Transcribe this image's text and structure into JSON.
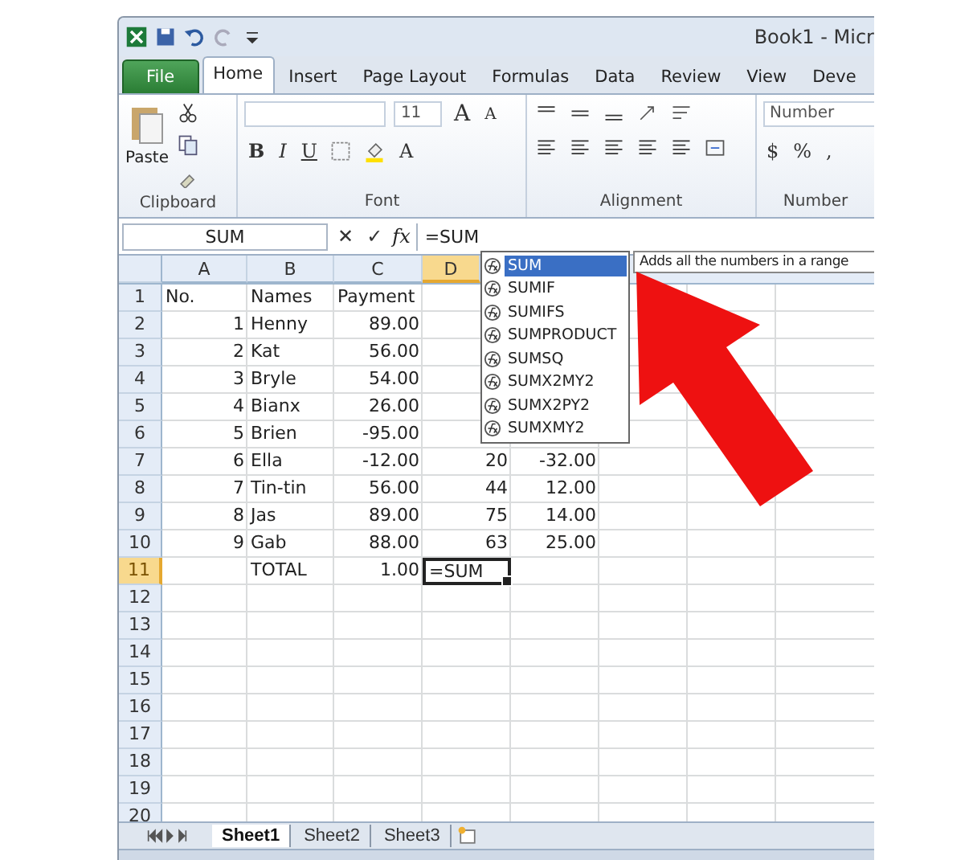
{
  "window": {
    "title": "Book1 - Micr"
  },
  "tabs": [
    {
      "label": "File",
      "kind": "file",
      "selected": false
    },
    {
      "label": "Home",
      "kind": "tab",
      "selected": true
    },
    {
      "label": "Insert",
      "kind": "tab",
      "selected": false
    },
    {
      "label": "Page Layout",
      "kind": "tab",
      "selected": false
    },
    {
      "label": "Formulas",
      "kind": "tab",
      "selected": false
    },
    {
      "label": "Data",
      "kind": "tab",
      "selected": false
    },
    {
      "label": "Review",
      "kind": "tab",
      "selected": false
    },
    {
      "label": "View",
      "kind": "tab",
      "selected": false
    },
    {
      "label": "Deve",
      "kind": "tab",
      "selected": false
    }
  ],
  "ribbon": {
    "clipboard": {
      "paste_label": "Paste",
      "group_label": "Clipboard"
    },
    "font": {
      "size": "11",
      "grow": "A",
      "shrink": "A",
      "styles": [
        "B",
        "I",
        "U"
      ],
      "color_letter": "A",
      "group_label": "Font"
    },
    "alignment": {
      "group_label": "Alignment"
    },
    "number": {
      "format": "Number",
      "buttons": [
        "$",
        "%",
        ","
      ],
      "group_label": "Number"
    }
  },
  "formula_bar": {
    "name_box": "SUM",
    "cancel": "✕",
    "enter": "✓",
    "function": "fx",
    "formula": "=SUM"
  },
  "columns": [
    {
      "label": "A",
      "selected": false
    },
    {
      "label": "B",
      "selected": false
    },
    {
      "label": "C",
      "selected": false
    },
    {
      "label": "D",
      "selected": true
    }
  ],
  "rows": [
    {
      "header": "1",
      "selected": false,
      "cells": [
        {
          "kind": "text",
          "value": "No."
        },
        {
          "kind": "text",
          "value": "Names"
        },
        {
          "kind": "text",
          "value": "Payment"
        }
      ]
    },
    {
      "header": "2",
      "selected": false,
      "cells": [
        {
          "kind": "number",
          "value": "1"
        },
        {
          "kind": "text",
          "value": "Henny"
        },
        {
          "kind": "number",
          "value": "89.00"
        }
      ]
    },
    {
      "header": "3",
      "selected": false,
      "cells": [
        {
          "kind": "number",
          "value": "2"
        },
        {
          "kind": "text",
          "value": "Kat"
        },
        {
          "kind": "number",
          "value": "56.00"
        }
      ]
    },
    {
      "header": "4",
      "selected": false,
      "cells": [
        {
          "kind": "number",
          "value": "3"
        },
        {
          "kind": "text",
          "value": "Bryle"
        },
        {
          "kind": "number",
          "value": "54.00"
        }
      ]
    },
    {
      "header": "5",
      "selected": false,
      "cells": [
        {
          "kind": "number",
          "value": "4"
        },
        {
          "kind": "text",
          "value": "Bianx"
        },
        {
          "kind": "number",
          "value": "26.00"
        }
      ]
    },
    {
      "header": "6",
      "selected": false,
      "cells": [
        {
          "kind": "number",
          "value": "5"
        },
        {
          "kind": "text",
          "value": "Brien"
        },
        {
          "kind": "number",
          "value": "-95.00"
        }
      ]
    },
    {
      "header": "7",
      "selected": false,
      "cells": [
        {
          "kind": "number",
          "value": "6"
        },
        {
          "kind": "text",
          "value": "Ella"
        },
        {
          "kind": "number",
          "value": "-12.00"
        },
        {
          "kind": "number",
          "value": "20"
        },
        {
          "kind": "number",
          "value": "-32.00"
        }
      ]
    },
    {
      "header": "8",
      "selected": false,
      "cells": [
        {
          "kind": "number",
          "value": "7"
        },
        {
          "kind": "text",
          "value": "Tin-tin"
        },
        {
          "kind": "number",
          "value": "56.00"
        },
        {
          "kind": "number",
          "value": "44"
        },
        {
          "kind": "number",
          "value": "12.00"
        }
      ]
    },
    {
      "header": "9",
      "selected": false,
      "cells": [
        {
          "kind": "number",
          "value": "8"
        },
        {
          "kind": "text",
          "value": "Jas"
        },
        {
          "kind": "number",
          "value": "89.00"
        },
        {
          "kind": "number",
          "value": "75"
        },
        {
          "kind": "number",
          "value": "14.00"
        }
      ]
    },
    {
      "header": "10",
      "selected": false,
      "cells": [
        {
          "kind": "number",
          "value": "9"
        },
        {
          "kind": "text",
          "value": "Gab"
        },
        {
          "kind": "number",
          "value": "88.00"
        },
        {
          "kind": "number",
          "value": "63"
        },
        {
          "kind": "number",
          "value": "25.00"
        }
      ]
    },
    {
      "header": "11",
      "selected": true,
      "cells": [
        {
          "kind": "blank"
        },
        {
          "kind": "text",
          "value": "TOTAL"
        },
        {
          "kind": "number",
          "value": "1.00"
        },
        {
          "kind": "editing",
          "value": "=SUM"
        }
      ]
    },
    {
      "header": "12",
      "selected": false
    },
    {
      "header": "13",
      "selected": false
    },
    {
      "header": "14",
      "selected": false
    },
    {
      "header": "15",
      "selected": false
    },
    {
      "header": "16",
      "selected": false
    },
    {
      "header": "17",
      "selected": false
    },
    {
      "header": "18",
      "selected": false
    },
    {
      "header": "19",
      "selected": false
    },
    {
      "header": "20",
      "selected": false
    }
  ],
  "autocomplete": {
    "items": [
      {
        "label": "SUM",
        "selected": true
      },
      {
        "label": "SUMIF",
        "selected": false
      },
      {
        "label": "SUMIFS",
        "selected": false
      },
      {
        "label": "SUMPRODUCT",
        "selected": false
      },
      {
        "label": "SUMSQ",
        "selected": false
      },
      {
        "label": "SUMX2MY2",
        "selected": false
      },
      {
        "label": "SUMX2PY2",
        "selected": false
      },
      {
        "label": "SUMXMY2",
        "selected": false
      }
    ],
    "tooltip": "Adds all the numbers in a range"
  },
  "sheet_tabs": [
    {
      "label": "Sheet1",
      "selected": true
    },
    {
      "label": "Sheet2",
      "selected": false
    },
    {
      "label": "Sheet3",
      "selected": false
    }
  ]
}
